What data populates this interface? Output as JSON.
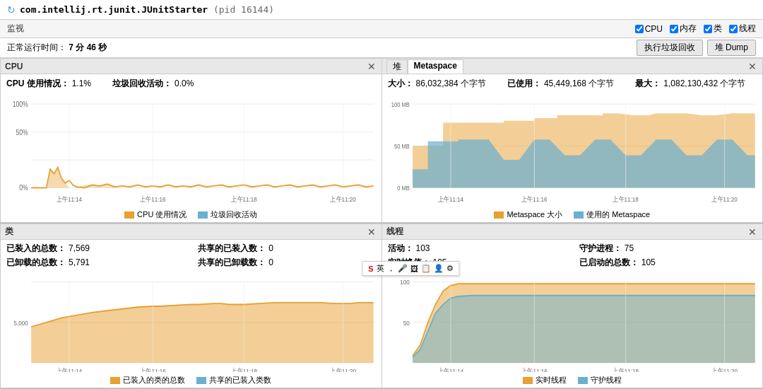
{
  "titleBar": {
    "icon": "↻",
    "processName": "com.intellij.rt.junit.JUnitStarter",
    "pid": "(pid 16144)"
  },
  "header": {
    "monitorLabel": "监视",
    "checkboxes": [
      {
        "label": "CPU",
        "checked": true
      },
      {
        "label": "内存",
        "checked": true
      },
      {
        "label": "类",
        "checked": true
      },
      {
        "label": "线程",
        "checked": true
      }
    ]
  },
  "uptime": {
    "label": "正常运行时间：",
    "value": "7 分 46 秒"
  },
  "actions": {
    "gcButton": "执行垃圾回收",
    "dumpButton": "堆 Dump"
  },
  "panels": {
    "cpu": {
      "title": "CPU",
      "stats": [
        {
          "label": "CPU 使用情况：",
          "value": "1.1%"
        },
        {
          "label": "垃圾回收活动：",
          "value": "0.0%"
        }
      ],
      "legend": [
        {
          "label": "CPU 使用情况",
          "color": "#e8a030"
        },
        {
          "label": "垃圾回收活动",
          "color": "#6ab0d0"
        }
      ],
      "yLabels": [
        "100%",
        "50%",
        "0%"
      ],
      "xLabels": [
        "上午11:14",
        "上午11:16",
        "上午11:18",
        "上午11:20"
      ]
    },
    "heap": {
      "title": "堆",
      "tabs": [
        "堆",
        "Metaspace"
      ],
      "activeTab": "Metaspace",
      "stats": [
        {
          "label": "大小：",
          "value": "86,032,384 个字节"
        },
        {
          "label": "已使用：",
          "value": "45,449,168 个字节"
        },
        {
          "label": "最大：",
          "value": "1,082,130,432 个字节"
        }
      ],
      "legend": [
        {
          "label": "Metaspace 大小",
          "color": "#e8a030"
        },
        {
          "label": "使用的 Metaspace",
          "color": "#6ab0d0"
        }
      ],
      "yLabels": [
        "100 MB",
        "50 MB",
        "0 MB"
      ],
      "xLabels": [
        "上午11:14",
        "上午11:16",
        "上午11:18",
        "上午11:20"
      ]
    },
    "classes": {
      "title": "类",
      "stats": [
        {
          "label": "已装入的总数：",
          "value": "7,569"
        },
        {
          "label": "共享的已装入数：",
          "value": "0"
        },
        {
          "label": "已卸载的总数：",
          "value": "5,791"
        },
        {
          "label": "共享的已卸载数：",
          "value": "0"
        }
      ],
      "legend": [
        {
          "label": "已装入的类的总数",
          "color": "#e8a030"
        },
        {
          "label": "共享的已装入类数",
          "color": "#6ab0d0"
        }
      ],
      "yLabels": [
        "",
        "5,000",
        ""
      ],
      "xLabels": [
        "上午11:14",
        "上午11:16",
        "上午11:18",
        "上午11:20"
      ]
    },
    "threads": {
      "title": "线程",
      "stats": [
        {
          "label": "活动：",
          "value": "103"
        },
        {
          "label": "守护进程：",
          "value": "75"
        },
        {
          "label": "实时峰值：",
          "value": "105"
        },
        {
          "label": "已启动的总数：",
          "value": "105"
        }
      ],
      "legend": [
        {
          "label": "实时线程",
          "color": "#e8a030"
        },
        {
          "label": "守护线程",
          "color": "#6ab0d0"
        }
      ],
      "yLabels": [
        "100",
        "50",
        ""
      ],
      "xLabels": [
        "上午11:14",
        "上午11:16",
        "上午11:18",
        "上午11:20"
      ]
    }
  },
  "tooltip": {
    "icon": "S",
    "items": [
      "英",
      "🎤",
      "🖼",
      "📋",
      "👤",
      "⚙"
    ]
  }
}
